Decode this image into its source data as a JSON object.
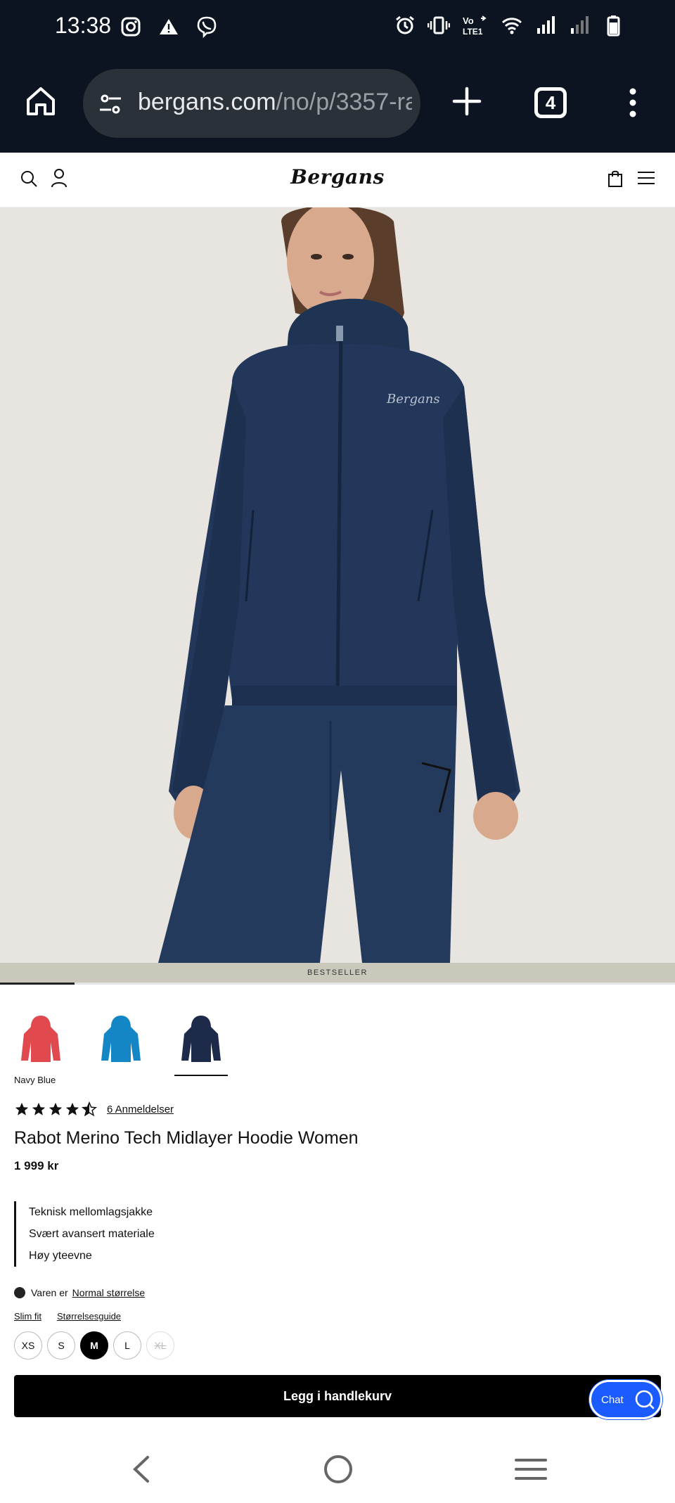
{
  "status_bar": {
    "time": "13:38",
    "left_icons": [
      "instagram-icon",
      "warning-icon",
      "viber-icon"
    ],
    "right_icons": [
      "alarm-icon",
      "vibrate-icon",
      "volte-icon",
      "wifi-icon",
      "signal-icon",
      "signal-weak-icon",
      "battery-icon"
    ],
    "volte_label": "Vo LTE1"
  },
  "browser": {
    "url_host": "bergans.com",
    "url_path": "/no/p/3357-ra",
    "tab_count": "4"
  },
  "site": {
    "logo": "Bergans"
  },
  "product": {
    "badge": "BESTSELLER",
    "image_progress": 0.11,
    "swatches": [
      {
        "name": "red",
        "color": "#e04a4f"
      },
      {
        "name": "blue",
        "color": "#1486c6"
      },
      {
        "name": "navy",
        "color": "#1e2a4a"
      }
    ],
    "selected_swatch": 2,
    "color_name": "Navy Blue",
    "rating": 4.5,
    "reviews_label": "6 Anmeldelser",
    "title": "Rabot Merino Tech Midlayer Hoodie Women",
    "price": "1 999 kr",
    "features": [
      "Teknisk mellomlagsjakke",
      "Svært avansert materiale",
      "Høy yteevne"
    ],
    "fit_prefix": "Varen er",
    "fit_link": "Normal størrelse",
    "fit_type": "Slim fit",
    "size_guide": "Størrelsesguide",
    "sizes": [
      "XS",
      "S",
      "M",
      "L",
      "XL"
    ],
    "selected_size": "M",
    "unavailable_sizes": [
      "XL"
    ],
    "add_to_cart": "Legg i handlekurv",
    "chat_label": "Chat"
  }
}
